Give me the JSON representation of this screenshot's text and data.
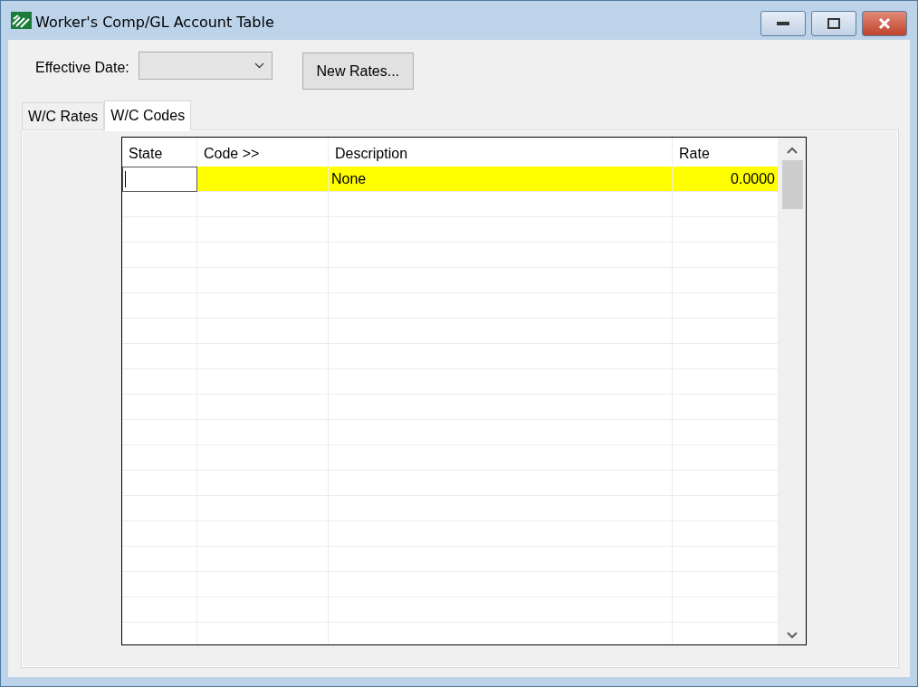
{
  "window": {
    "title": "Worker's Comp/GL Account Table"
  },
  "toolbar": {
    "effective_date_label": "Effective Date:",
    "new_rates_button": "New Rates..."
  },
  "tabs": [
    {
      "label": "W/C Rates",
      "selected": false
    },
    {
      "label": "W/C Codes",
      "selected": true
    }
  ],
  "table": {
    "columns": [
      {
        "label": "State",
        "kind": "text"
      },
      {
        "label": "Code >>",
        "kind": "text"
      },
      {
        "label": "Description",
        "kind": "text"
      },
      {
        "label": "Rate",
        "kind": "number"
      }
    ],
    "rows": [
      {
        "selected": true,
        "cells": [
          {
            "text": "",
            "editing": true
          },
          {
            "text": "",
            "editing": false
          },
          {
            "text": "None",
            "editing": false
          },
          {
            "text": "0.0000",
            "editing": false
          }
        ]
      }
    ]
  }
}
